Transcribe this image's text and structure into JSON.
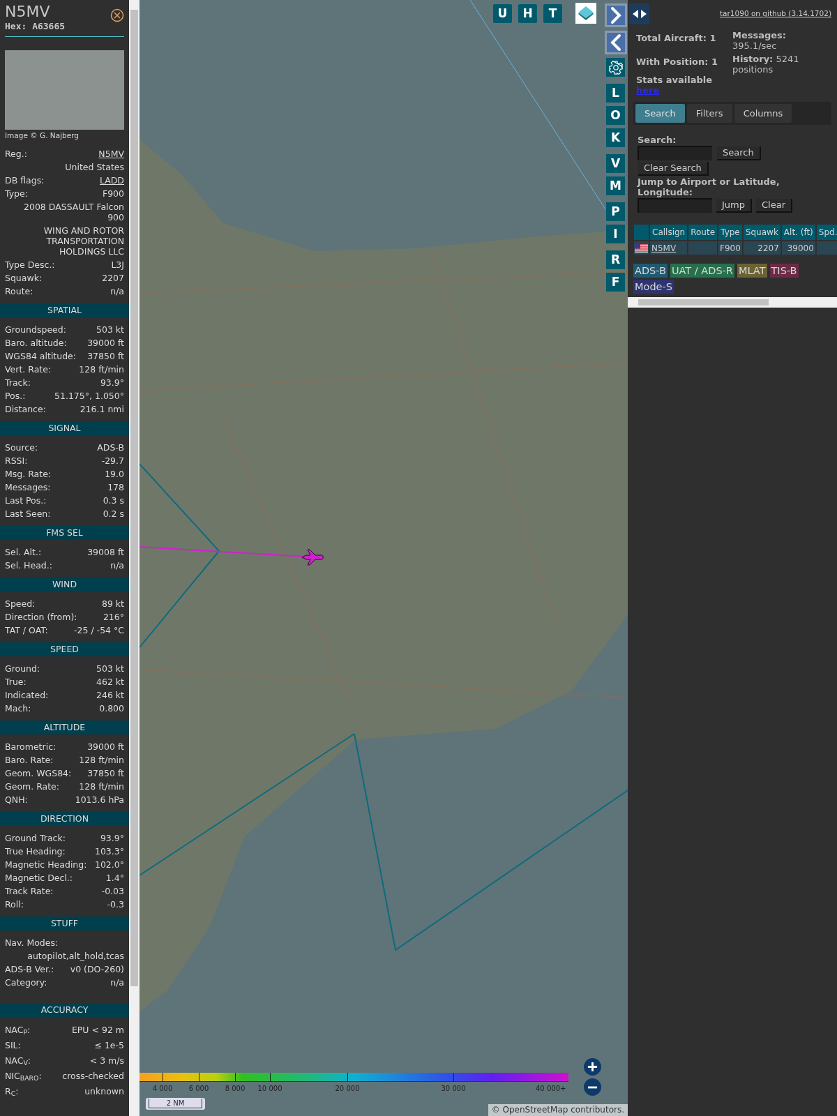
{
  "detail": {
    "callsign": "N5MV",
    "hex": "Hex: A63665",
    "photo_credit": "Image © G. Najberg",
    "info": [
      {
        "kind": "pair",
        "label": "Reg.:",
        "value": "N5MV",
        "link": true
      },
      {
        "kind": "note",
        "value": "United States"
      },
      {
        "kind": "pair",
        "label": "DB flags:",
        "value": "LADD",
        "link": true
      },
      {
        "kind": "pair",
        "label": "Type:",
        "value": "F900",
        "link": false
      },
      {
        "kind": "note",
        "value": "2008 DASSAULT Falcon 900"
      },
      {
        "kind": "note",
        "value": "WING AND ROTOR TRANSPORTATION HOLDINGS LLC"
      },
      {
        "kind": "pair",
        "label": "Type Desc.:",
        "value": "L3J",
        "link": false
      },
      {
        "kind": "pair",
        "label": "Squawk:",
        "value": "2207",
        "link": false
      },
      {
        "kind": "pair",
        "label": "Route:",
        "value": "n/a",
        "link": false
      }
    ],
    "sections": [
      {
        "title": "SPATIAL",
        "rows": [
          {
            "label": "Groundspeed:",
            "value": "503 kt"
          },
          {
            "label": "Baro. altitude:",
            "value": "39000 ft"
          },
          {
            "label": "WGS84 altitude:",
            "value": "37850 ft"
          },
          {
            "label": "Vert. Rate:",
            "value": "128 ft/min"
          },
          {
            "label": "Track:",
            "value": "93.9°"
          },
          {
            "label": "Pos.:",
            "value": "51.175°, 1.050°"
          },
          {
            "label": "Distance:",
            "value": "216.1 nmi"
          }
        ]
      },
      {
        "title": "SIGNAL",
        "rows": [
          {
            "label": "Source:",
            "value": "ADS-B"
          },
          {
            "label": "RSSI:",
            "value": "-29.7"
          },
          {
            "label": "Msg. Rate:",
            "value": "19.0"
          },
          {
            "label": "Messages:",
            "value": "178"
          },
          {
            "label": "Last Pos.:",
            "value": "0.3 s"
          },
          {
            "label": "Last Seen:",
            "value": "0.2 s"
          }
        ]
      },
      {
        "title": "FMS SEL",
        "rows": [
          {
            "label": "Sel. Alt.:",
            "value": "39008 ft"
          },
          {
            "label": "Sel. Head.:",
            "value": "n/a"
          }
        ]
      },
      {
        "title": "WIND",
        "rows": [
          {
            "label": "Speed:",
            "value": "89 kt"
          },
          {
            "label": "Direction (from):",
            "value": "216°"
          },
          {
            "label": "TAT / OAT:",
            "value": "-25 / -54 °C"
          }
        ]
      },
      {
        "title": "SPEED",
        "rows": [
          {
            "label": "Ground:",
            "value": "503 kt"
          },
          {
            "label": "True:",
            "value": "462 kt"
          },
          {
            "label": "Indicated:",
            "value": "246 kt"
          },
          {
            "label": "Mach:",
            "value": "0.800"
          }
        ]
      },
      {
        "title": "ALTITUDE",
        "rows": [
          {
            "label": "Barometric:",
            "value": "39000 ft"
          },
          {
            "label": "Baro. Rate:",
            "value": "128 ft/min"
          },
          {
            "label": "Geom. WGS84:",
            "value": "37850 ft"
          },
          {
            "label": "Geom. Rate:",
            "value": "128 ft/min"
          },
          {
            "label": "QNH:",
            "value": "1013.6 hPa"
          }
        ]
      },
      {
        "title": "DIRECTION",
        "rows": [
          {
            "label": "Ground Track:",
            "value": "93.9°"
          },
          {
            "label": "True Heading:",
            "value": "103.3°"
          },
          {
            "label": "Magnetic Heading:",
            "value": "102.0°"
          },
          {
            "label": "Magnetic Decl.:",
            "value": "1.4°"
          },
          {
            "label": "Track Rate:",
            "value": "-0.03"
          },
          {
            "label": "Roll:",
            "value": "-0.3"
          }
        ]
      },
      {
        "title": "STUFF",
        "rows": [
          {
            "label": "Nav. Modes:",
            "value": "autopilot,alt_hold,tcas",
            "stacked": true
          },
          {
            "label": "ADS-B Ver.:",
            "value": "v0 (DO-260)"
          },
          {
            "label": "Category:",
            "value": "n/a"
          }
        ]
      },
      {
        "title": "ACCURACY",
        "rows": [
          {
            "label": "NAC$_{P}$:",
            "value": "EPU < 92 m"
          },
          {
            "label": "SIL:",
            "value": "≤ 1e-5"
          },
          {
            "label": "NAC$_{V}$:",
            "value": "< 3 m/s"
          },
          {
            "label": "NIC$_{BARO}$:",
            "value": "cross-checked"
          },
          {
            "label": "R$_{C}$:",
            "value": "unknown"
          }
        ]
      }
    ]
  },
  "map": {
    "top_buttons": [
      "U",
      "H",
      "T"
    ],
    "side_buttons": [
      [
        {
          "kind": "next"
        },
        {
          "kind": "prev"
        },
        {
          "kind": "settings"
        }
      ],
      [
        {
          "kind": "letter",
          "label": "L"
        },
        {
          "kind": "letter",
          "label": "O"
        },
        {
          "kind": "letter",
          "label": "K"
        }
      ],
      [
        {
          "kind": "letter",
          "label": "V"
        },
        {
          "kind": "letter",
          "label": "M"
        }
      ],
      [
        {
          "kind": "letter",
          "label": "P"
        },
        {
          "kind": "letter",
          "label": "I"
        }
      ],
      [
        {
          "kind": "letter",
          "label": "R"
        },
        {
          "kind": "letter",
          "label": "F"
        }
      ]
    ],
    "altitude_legend": [
      "4 000",
      "6 000",
      "8 000",
      "10 000",
      "20 000",
      "30 000",
      "40 000+"
    ],
    "scale": "2 NM",
    "attribution": "© OpenStreetMap contributors."
  },
  "sidebar": {
    "github_link": "tar1090 on github (3.14.1702)",
    "stats": [
      {
        "label": "Total Aircraft:",
        "value": "1"
      },
      {
        "label": "With Position:",
        "value": "1"
      }
    ],
    "stats_note": "Stats available",
    "stats_link": "here",
    "messages": {
      "label": "Messages:",
      "value": "395.1/sec"
    },
    "history": {
      "label": "History:",
      "value": "5241 positions"
    },
    "tabs": [
      {
        "label": "Search",
        "selected": true
      },
      {
        "label": "Filters",
        "selected": false
      },
      {
        "label": "Columns",
        "selected": false
      }
    ],
    "search": {
      "label": "Search:",
      "button": "Search",
      "clear_button": "Clear Search"
    },
    "jump": {
      "label": "Jump to Airport or Latitude, Longitude:",
      "button": "Jump",
      "clear_button": "Clear"
    },
    "table": {
      "columns": [
        "Callsign",
        "Route",
        "Type",
        "Squawk",
        "Alt. (ft)",
        "Spd."
      ],
      "rows": [
        {
          "callsign": "N5MV",
          "type": "F900",
          "squawk": "2207",
          "altitude": "39000"
        }
      ]
    },
    "sources": [
      {
        "label": "ADS-B",
        "color": "#1f5a70"
      },
      {
        "label": "UAT / ADS-R",
        "color": "#27704c"
      },
      {
        "label": "MLAT",
        "color": "#6a6232"
      },
      {
        "label": "TIS-B",
        "color": "#6c2a44"
      },
      {
        "label": "Mode-S",
        "color": "#2e3470"
      }
    ]
  }
}
